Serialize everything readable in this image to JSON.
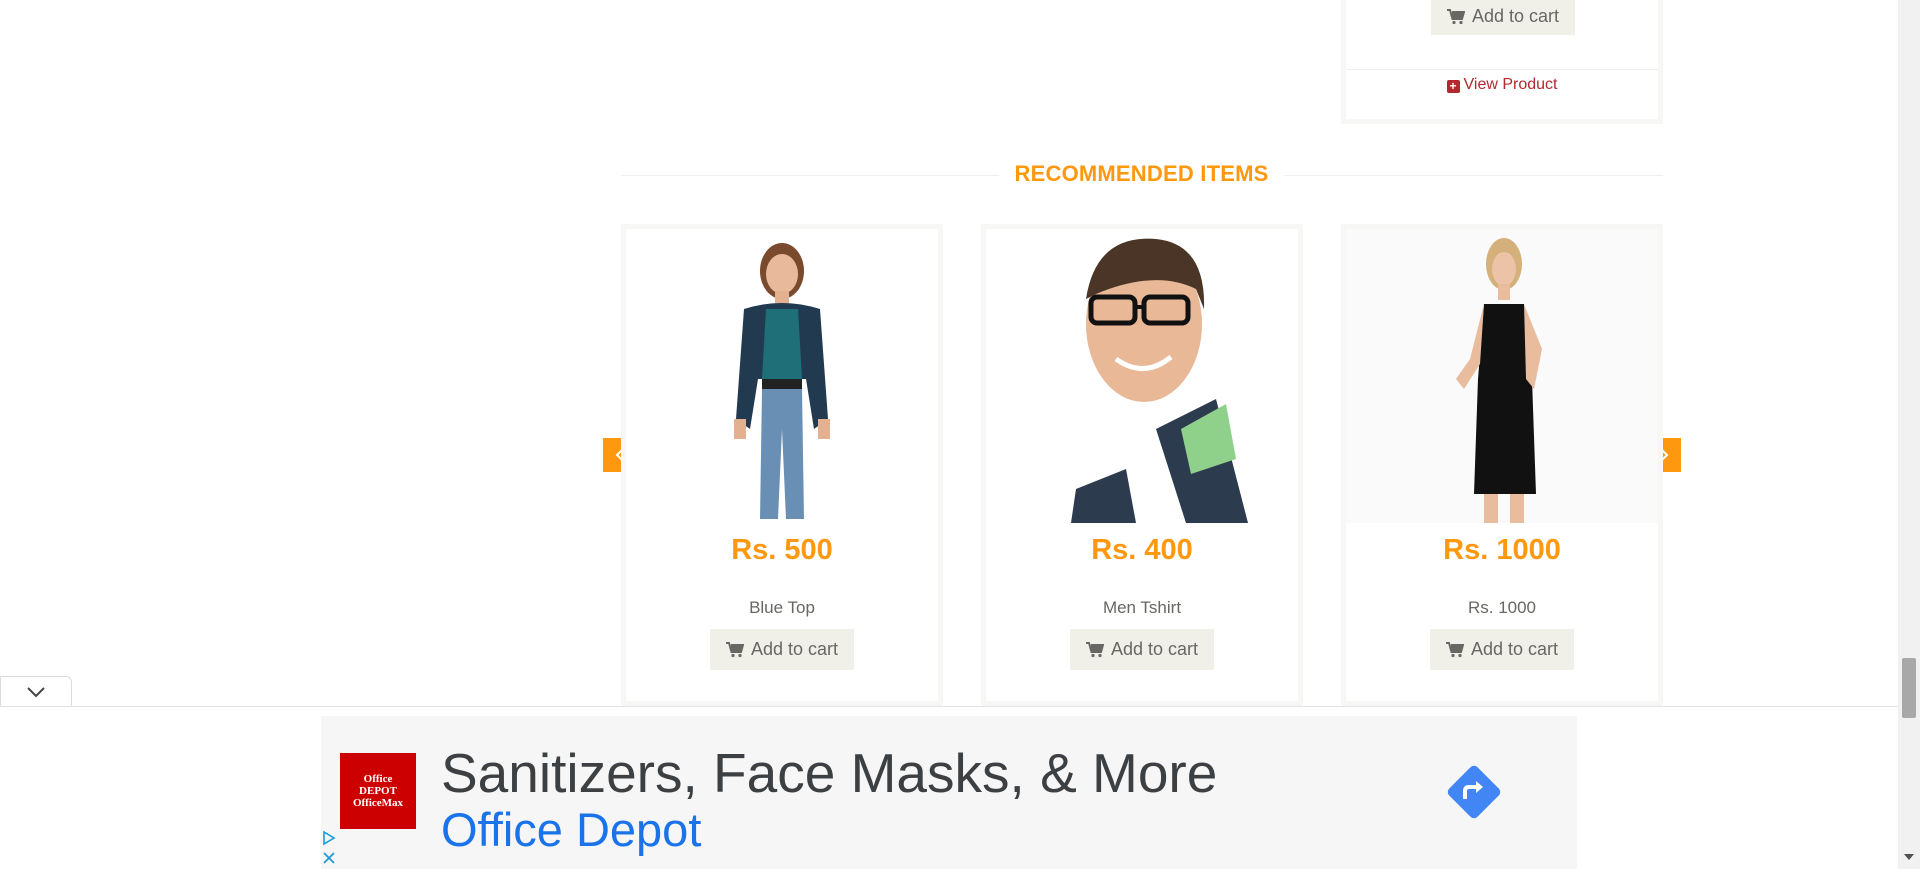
{
  "top_card": {
    "add_to_cart": "Add to cart",
    "view_product": "View Product"
  },
  "recommended": {
    "title": "RECOMMENDED ITEMS",
    "items": [
      {
        "price": "Rs. 500",
        "name": "Blue Top",
        "add_to_cart": "Add to cart"
      },
      {
        "price": "Rs. 400",
        "name": "Men Tshirt",
        "add_to_cart": "Add to cart"
      },
      {
        "price": "Rs. 1000",
        "name": "Rs. 1000",
        "add_to_cart": "Add to cart"
      }
    ]
  },
  "ad": {
    "logo_text": "Office DEPOT OfficeMax",
    "headline": "Sanitizers, Face Masks, & More",
    "brand": "Office Depot"
  },
  "colors": {
    "accent": "#fe980f",
    "view_product": "#b3282d",
    "ad_brand": "#1a73e8",
    "ad_logo": "#cc0000"
  },
  "icons": [
    "shopping-cart-icon",
    "plus-square-icon",
    "chevron-left-icon",
    "chevron-right-icon",
    "chevron-down-icon",
    "directions-arrow-icon",
    "adchoices-icon",
    "close-icon"
  ]
}
